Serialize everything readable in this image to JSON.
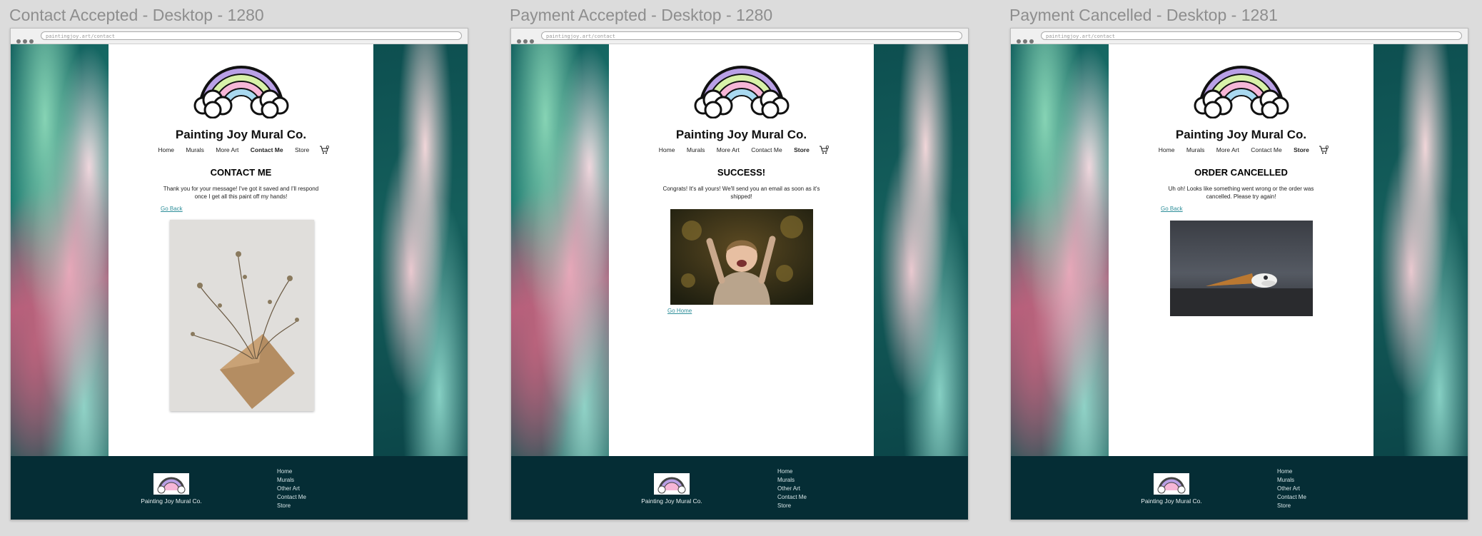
{
  "frames": [
    {
      "title": "Contact Accepted - Desktop - 1280",
      "url": "paintingjoy.art/contact",
      "site_title": "Painting Joy Mural Co.",
      "nav": [
        "Home",
        "Murals",
        "More Art",
        "Contact Me",
        "Store"
      ],
      "active_nav": "Contact Me",
      "heading": "CONTACT ME",
      "message": "Thank you for your message! I've got it saved and I'll respond once I get all this paint off my hands!",
      "link_label": "Go Back",
      "photo_subject": "dried flowers in kraft envelope",
      "footer_name": "Painting Joy Mural Co.",
      "footer_links": [
        "Home",
        "Murals",
        "Other Art",
        "Contact Me",
        "Store"
      ]
    },
    {
      "title": "Payment Accepted - Desktop - 1280",
      "url": "paintingjoy.art/contact",
      "site_title": "Painting Joy Mural Co.",
      "nav": [
        "Home",
        "Murals",
        "More Art",
        "Contact Me",
        "Store"
      ],
      "active_nav": "Store",
      "heading": "SUCCESS!",
      "message": "Congrats! It's all yours! We'll send you an email as soon as it's shipped!",
      "link_label": "Go Home",
      "photo_subject": "excited child cheering",
      "footer_name": "Painting Joy Mural Co.",
      "footer_links": [
        "Home",
        "Murals",
        "Other Art",
        "Contact Me",
        "Store"
      ]
    },
    {
      "title": "Payment Cancelled - Desktop - 1281",
      "url": "paintingjoy.art/contact",
      "site_title": "Painting Joy Mural Co.",
      "nav": [
        "Home",
        "Murals",
        "More Art",
        "Contact Me",
        "Store"
      ],
      "active_nav": "Store",
      "heading": "ORDER CANCELLED",
      "message": "Uh oh! Looks like something went wrong or the order was cancelled. Please try again!",
      "link_label": "Go Back",
      "photo_subject": "dropped ice cream cone",
      "footer_name": "Painting Joy Mural Co.",
      "footer_links": [
        "Home",
        "Murals",
        "Other Art",
        "Contact Me",
        "Store"
      ]
    }
  ],
  "colors": {
    "footer_bg": "#052d35",
    "link": "#2f8f9a",
    "page_bg": "#dcdcdc"
  },
  "icons": [
    "cart-icon",
    "rainbow-logo"
  ]
}
